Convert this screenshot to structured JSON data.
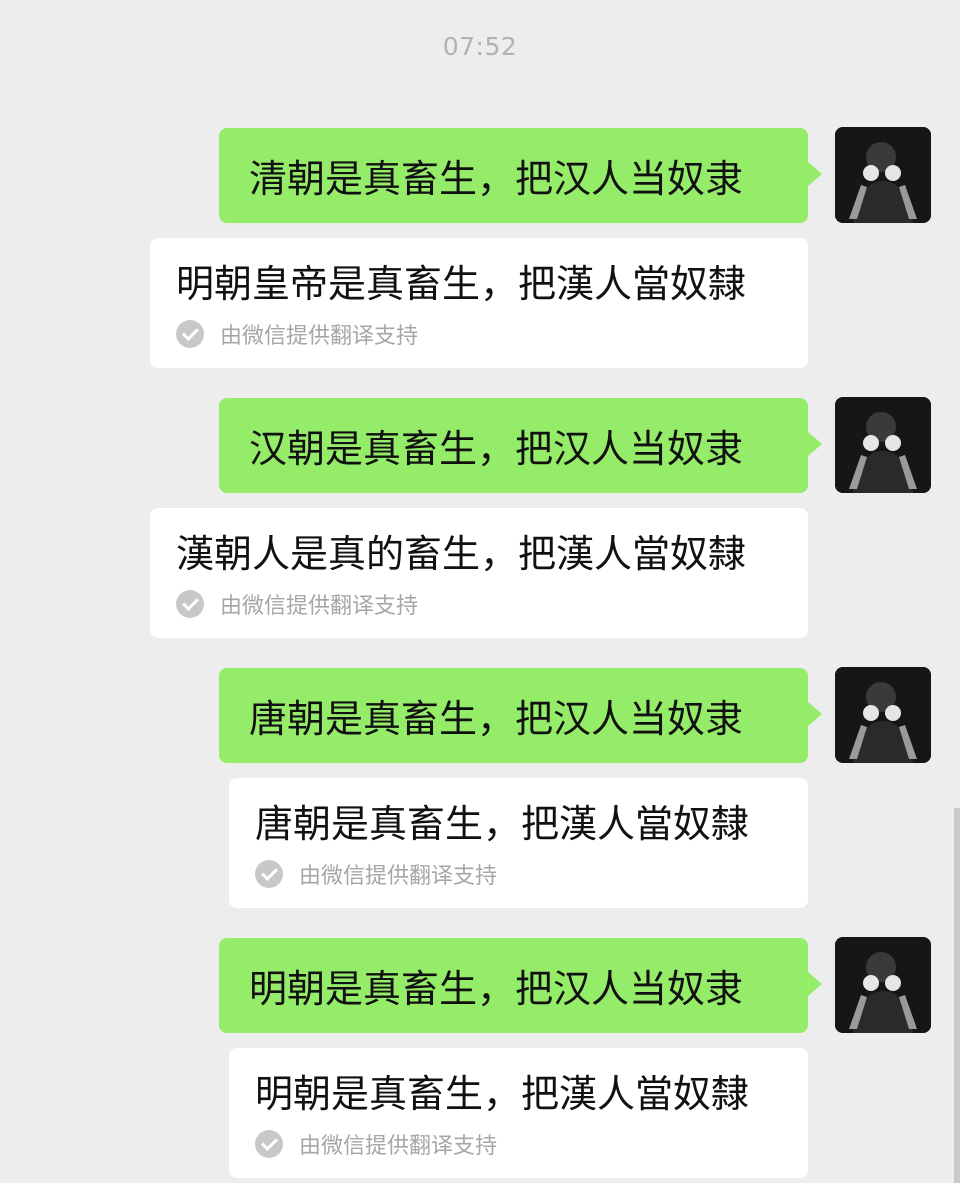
{
  "status": {
    "time": "07:52"
  },
  "messages": [
    {
      "sent": "清朝是真畜生，把汉人当奴隶",
      "translation": "明朝皇帝是真畜生，把漢人當奴隸",
      "note": "由微信提供翻译支持"
    },
    {
      "sent": "汉朝是真畜生，把汉人当奴隶",
      "translation": "漢朝人是真的畜生，把漢人當奴隸",
      "note": "由微信提供翻译支持"
    },
    {
      "sent": "唐朝是真畜生，把汉人当奴隶",
      "translation": "唐朝是真畜生，把漢人當奴隸",
      "note": "由微信提供翻译支持"
    },
    {
      "sent": "明朝是真畜生，把汉人当奴隶",
      "translation": "明朝是真畜生，把漢人當奴隸",
      "note": "由微信提供翻译支持"
    }
  ],
  "icons": {
    "avatar": "avatar-photo",
    "translate_done": "check-circle-icon"
  },
  "colors": {
    "sent_bubble": "#95ec69",
    "translation_card": "#ffffff",
    "chat_background": "#ededed"
  }
}
